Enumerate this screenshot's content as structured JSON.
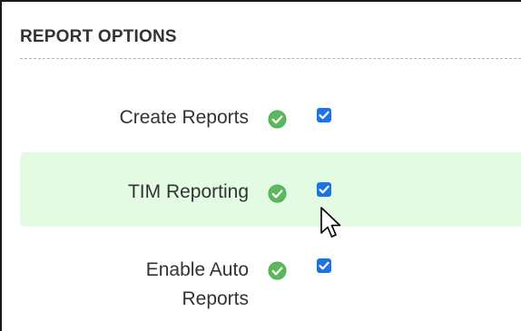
{
  "section": {
    "title": "REPORT OPTIONS"
  },
  "options": [
    {
      "label": "Create Reports",
      "status_icon": "check-circle-icon",
      "checked": true
    },
    {
      "label": "TIM Reporting",
      "status_icon": "check-circle-icon",
      "checked": true
    },
    {
      "label_line1": "Enable Auto",
      "label_line2": "Reports",
      "status_icon": "check-circle-icon",
      "checked": true
    }
  ],
  "colors": {
    "highlight_row": "#e3fae3",
    "status_ok": "#5cb85c",
    "checkbox": "#1a73e8",
    "text": "#333333"
  }
}
